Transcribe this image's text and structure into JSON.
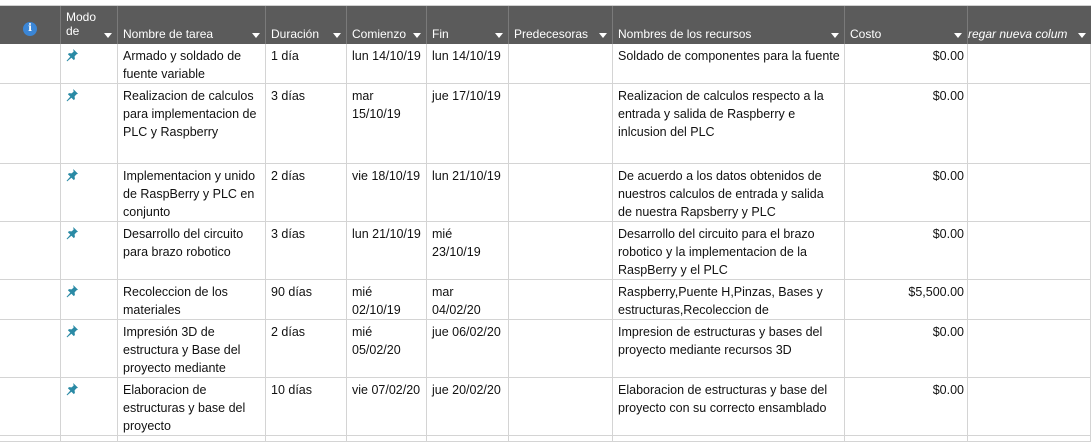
{
  "header": {
    "info_glyph": "i",
    "modo": "Modo de",
    "nombre": "Nombre de tarea",
    "duracion": "Duración",
    "comienzo": "Comienzo",
    "fin": "Fin",
    "predecesoras": "Predecesoras",
    "recursos": "Nombres de los recursos",
    "costo": "Costo",
    "agregar": "regar nueva colum"
  },
  "colors": {
    "header_bg": "#5b5b5b",
    "pin": "#2a8aa5",
    "info": "#3b86d6"
  },
  "rows": [
    {
      "mode_icon": "pin-icon",
      "name": "Armado y soldado de fuente variable",
      "duration": "1 día",
      "start": "lun 14/10/19",
      "finish": "lun 14/10/19",
      "pred": "",
      "resources": "Soldado de componentes para la fuente",
      "cost": "$0.00"
    },
    {
      "mode_icon": "pin-icon",
      "name": "Realizacion de calculos para implementacion de PLC y Raspberry",
      "duration": "3 días",
      "start": "mar 15/10/19",
      "finish": "jue 17/10/19",
      "pred": "",
      "resources": "Realizacion de calculos respecto a la entrada y salida de Raspberry e inlcusion del PLC",
      "cost": "$0.00"
    },
    {
      "mode_icon": "pin-icon",
      "name": "Implementacion y unido de RaspBerry y PLC en conjunto",
      "duration": "2 días",
      "start": "vie 18/10/19",
      "finish": "lun 21/10/19",
      "pred": "",
      "resources": "De acuerdo a los datos obtenidos de nuestros calculos de entrada y salida de nuestra Rapsberry y PLC",
      "cost": "$0.00"
    },
    {
      "mode_icon": "pin-icon",
      "name": "Desarrollo del circuito para brazo robotico",
      "duration": "3 días",
      "start": "lun 21/10/19",
      "finish": "mié 23/10/19",
      "pred": "",
      "resources": "Desarrollo del circuito para el brazo robotico y la implementacion de la RaspBerry y el PLC",
      "cost": "$0.00"
    },
    {
      "mode_icon": "pin-icon",
      "name": "Recoleccion de los materiales",
      "duration": "90 días",
      "start": "mié 02/10/19",
      "finish": "mar 04/02/20",
      "pred": "",
      "resources": "Raspberry,Puente H,Pinzas, Bases y estructuras,Recoleccion de",
      "cost": "$5,500.00"
    },
    {
      "mode_icon": "pin-icon",
      "name": "Impresión 3D de estructura y Base del proyecto mediante",
      "duration": "2 días",
      "start": "mié 05/02/20",
      "finish": "jue 06/02/20",
      "pred": "",
      "resources": "Impresion de estructuras y bases del proyecto mediante recursos 3D",
      "cost": "$0.00"
    },
    {
      "mode_icon": "pin-icon",
      "name": "Elaboracion de estructuras y base del proyecto",
      "duration": "10 días",
      "start": "vie 07/02/20",
      "finish": "jue 20/02/20",
      "pred": "",
      "resources": "Elaboracion de estructuras y base del proyecto con su correcto ensamblado",
      "cost": "$0.00"
    }
  ]
}
